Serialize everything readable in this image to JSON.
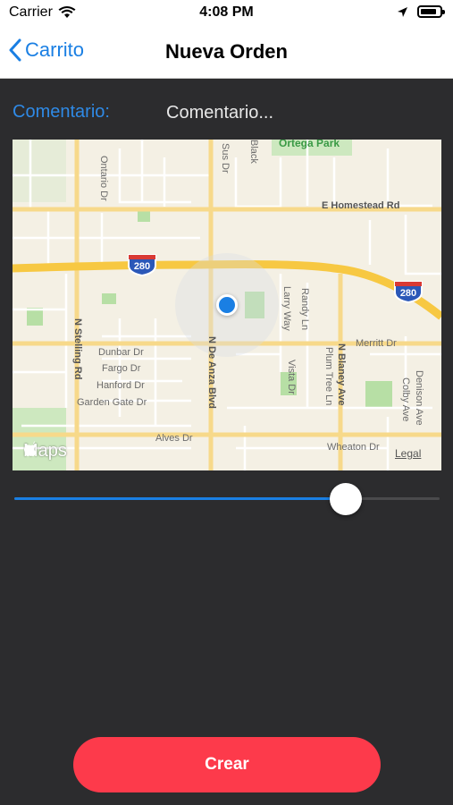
{
  "status_bar": {
    "carrier": "Carrier",
    "time": "4:08 PM",
    "icons": [
      "wifi-icon",
      "location-arrow-icon",
      "battery-icon"
    ]
  },
  "nav": {
    "back_label": "Carrito",
    "back_icon": "chevron-left-icon",
    "title": "Nueva Orden"
  },
  "form": {
    "comment_label": "Comentario:",
    "comment_placeholder": "Comentario...",
    "comment_value": ""
  },
  "map": {
    "labels": {
      "ortega_park": "Ortega Park",
      "homestead": "E Homestead Rd",
      "ontario": "Ontario Dr",
      "stelling": "N Stelling Rd",
      "de_anza": "N De Anza Blvd",
      "larry_way": "Larry Way",
      "randy_ln": "Randy Ln",
      "vista_dr": "Vista Dr",
      "blaney": "N Blaney Ave",
      "plum_tree": "Plum Tree Ln",
      "colby": "Colby Ave",
      "denison": "Denison Ave",
      "merritt": "Merritt Dr",
      "dunbar": "Dunbar Dr",
      "fargo": "Fargo Dr",
      "hanford": "Hanford Dr",
      "garden_gate": "Garden Gate Dr",
      "alves": "Alves Dr",
      "wheaton": "Wheaton Dr",
      "sus_dr": "Sus Dr",
      "black": "Black"
    },
    "highway_shield": "280",
    "attribution": "Maps",
    "legal": "Legal",
    "colors": {
      "land": "#f4f0e4",
      "highway": "#f7c842",
      "road": "#ffffff",
      "major_road": "#f7d98a",
      "park": "#b7dfa5",
      "location": "#1a7fe3"
    }
  },
  "slider": {
    "value": 0.78
  },
  "actions": {
    "create_label": "Crear",
    "create_color": "#fd3a4b"
  }
}
